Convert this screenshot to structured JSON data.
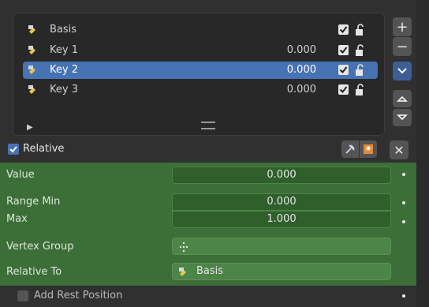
{
  "shape_keys": [
    {
      "label": "Basis",
      "value": "",
      "checked": true,
      "selected": false
    },
    {
      "label": "Key 1",
      "value": "0.000",
      "checked": true,
      "selected": false
    },
    {
      "label": "Key 2",
      "value": "0.000",
      "checked": true,
      "selected": true
    },
    {
      "label": "Key 3",
      "value": "0.000",
      "checked": true,
      "selected": false
    }
  ],
  "side_buttons": {
    "add": "+",
    "remove": "−",
    "specials": "⌄",
    "move_up": "⏶",
    "move_down": "⏷"
  },
  "relative": {
    "label": "Relative",
    "checked": true
  },
  "clear_button": "✕",
  "properties": {
    "value_label": "Value",
    "value": "0.000",
    "range_min_label": "Range Min",
    "range_min": "0.000",
    "max_label": "Max",
    "max": "1.000",
    "vertex_group_label": "Vertex Group",
    "vertex_group": "",
    "relative_to_label": "Relative To",
    "relative_to": "Basis"
  },
  "add_rest_position": {
    "label": "Add Rest Position",
    "checked": false
  },
  "colors": {
    "selected_row": "#4772b3",
    "panel_green": "#3c6e37",
    "field_green": "#2f5f2b"
  }
}
